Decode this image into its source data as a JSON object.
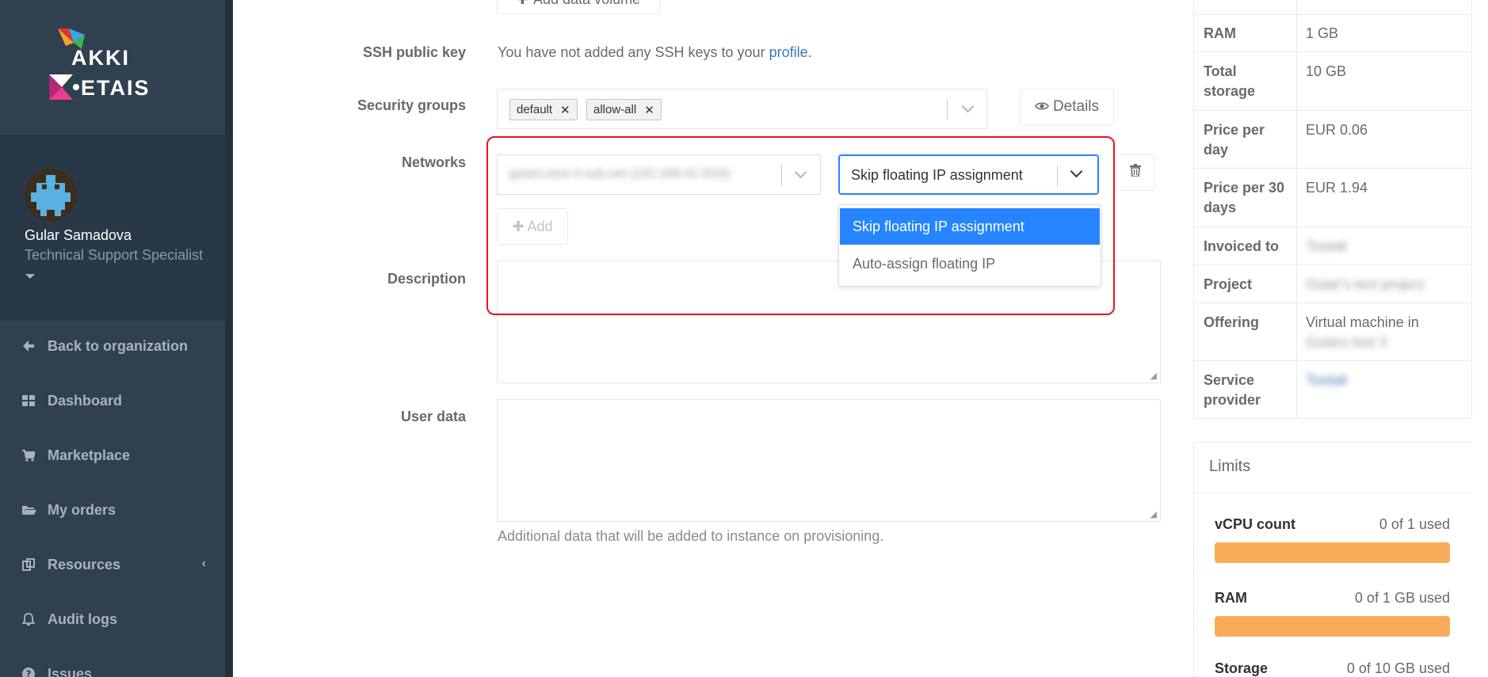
{
  "sidebar": {
    "logo_top": "AKKI",
    "logo_bottom": "ETAIS",
    "user_name": "Gular Samadova",
    "user_role": "Technical Support Specialist",
    "nav": [
      {
        "label": "Back to organization",
        "icon": "arrow-left-icon"
      },
      {
        "label": "Dashboard",
        "icon": "dashboard-icon"
      },
      {
        "label": "Marketplace",
        "icon": "cart-icon"
      },
      {
        "label": "My orders",
        "icon": "folder-open-icon"
      },
      {
        "label": "Resources",
        "icon": "files-icon"
      },
      {
        "label": "Audit logs",
        "icon": "bell-icon"
      },
      {
        "label": "Issues",
        "icon": "question-icon"
      }
    ]
  },
  "form": {
    "add_data_volume_label": "Add data volume",
    "ssh_label": "SSH public key",
    "ssh_text": "You have not added any SSH keys to your ",
    "ssh_link": "profile",
    "ssh_period": ".",
    "security_groups_label": "Security groups",
    "security_groups": [
      "default",
      "allow-all"
    ],
    "details_label": "Details",
    "networks_label": "Networks",
    "subnet_value": "gulars-test-3-sub-net (192.168.42.0/24)",
    "floating_ip_value": "Skip floating IP assignment",
    "add_label": "Add",
    "floating_ip_options": [
      "Skip floating IP assignment",
      "Auto-assign floating IP"
    ],
    "description_label": "Description",
    "user_data_label": "User data",
    "user_data_help": "Additional data that will be added to instance on provisioning."
  },
  "summary": {
    "rows": [
      {
        "key": "RAM",
        "value": "1 GB"
      },
      {
        "key": "Total storage",
        "value": "10 GB"
      },
      {
        "key": "Price per day",
        "value": "EUR 0.06"
      },
      {
        "key": "Price per 30 days",
        "value": "EUR 1.94"
      },
      {
        "key": "Invoiced to",
        "value": "Tootali"
      },
      {
        "key": "Project",
        "value": "Gular's test project"
      },
      {
        "key": "Offering",
        "value": "Virtual machine in",
        "value2": "Gulars test 3"
      },
      {
        "key": "Service provider",
        "value": "Tootali"
      }
    ]
  },
  "limits": {
    "title": "Limits",
    "items": [
      {
        "label": "vCPU count",
        "used": "0 of 1 used",
        "fill": 1.0
      },
      {
        "label": "RAM",
        "used": "0 of 1 GB used",
        "fill": 1.0
      },
      {
        "label": "Storage",
        "used": "0 of 10 GB used",
        "fill": 1.0
      }
    ]
  },
  "colors": {
    "sidebar_bg": "#2f4050",
    "link": "#337ab7",
    "selected_option": "#2684ff",
    "highlight_border": "#e8131f",
    "limit_bar": "#f8ac59"
  }
}
